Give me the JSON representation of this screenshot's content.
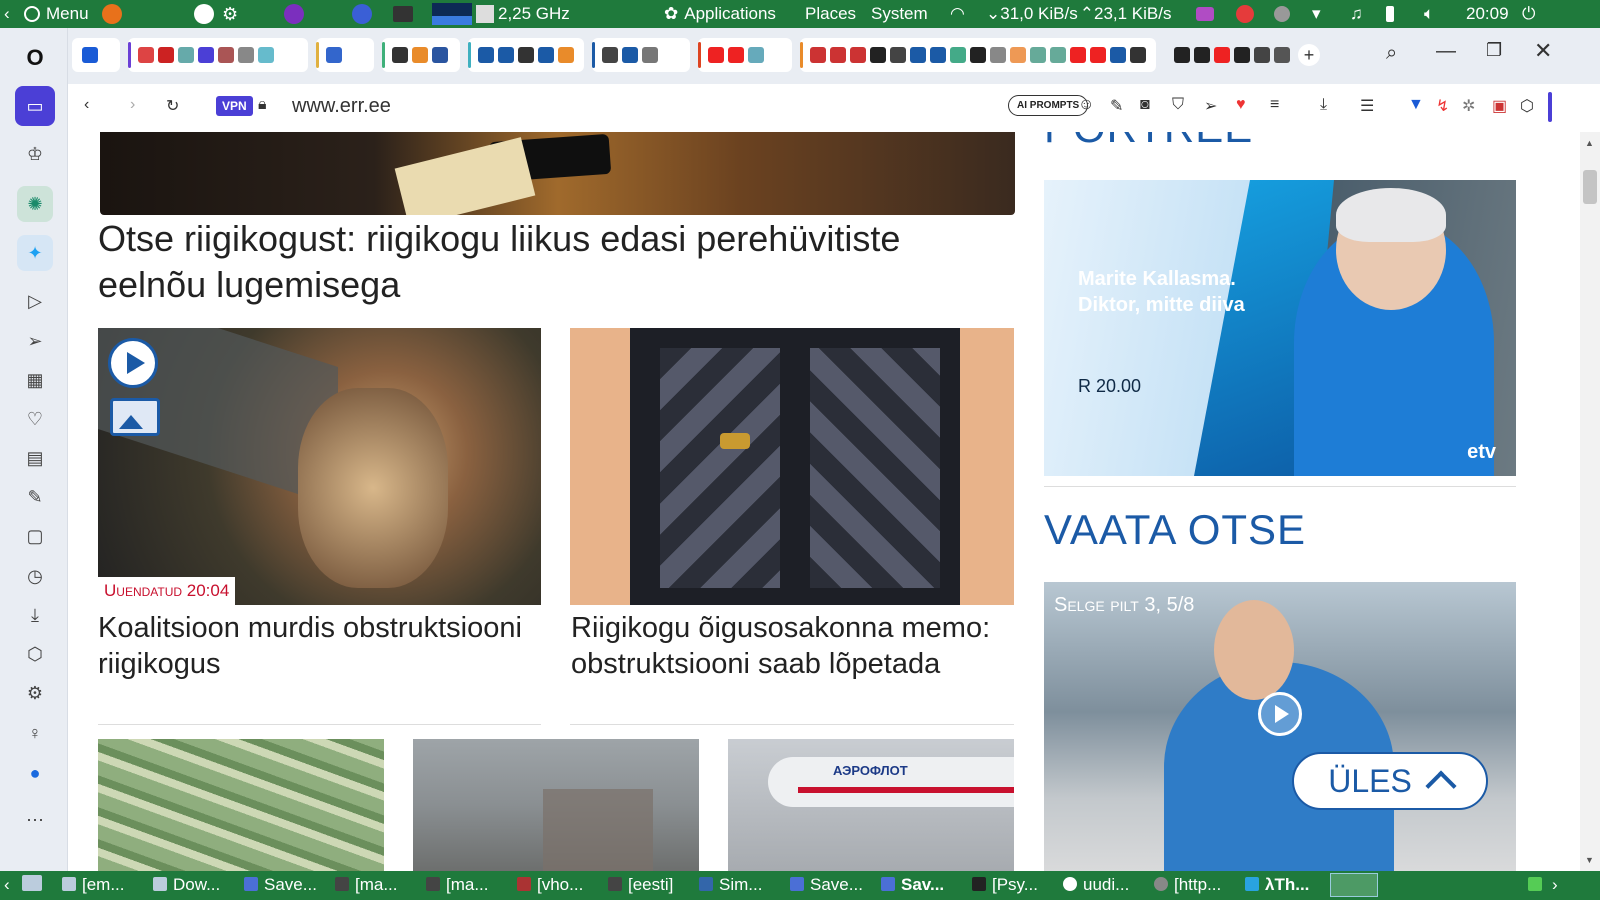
{
  "panel": {
    "menu": "Menu",
    "cpu": "2,25 GHz",
    "applications": "Applications",
    "places": "Places",
    "system": "System",
    "net_down": "31,0 KiB/s",
    "net_up": "23,1 KiB/s",
    "time": "20:09"
  },
  "browser": {
    "vpn": "VPN",
    "url": "www.err.ee",
    "ai_prompts": "AI PROMPTS"
  },
  "page": {
    "top_headline": "Otse riigikogust: riigikogu liikus edasi perehüvitiste eelnõu lugemisega",
    "article1": {
      "tag": "Uuendatud 20:04",
      "title": "Koalitsioon murdis obstruktsiooni riigikogus"
    },
    "article2": {
      "title": "Riigikogu õigusosakonna memo: obstruktsiooni saab lõpetada"
    },
    "sidebar_heading_partial": "PORTREE",
    "promo": {
      "line1": "Marite Kallasma.",
      "line2": "Diktor, mitte diiva",
      "time": "R 20.00",
      "brand": "etv"
    },
    "live_heading": "VAATA OTSE",
    "live_video": {
      "title": "Selge pilt 3, 5/8"
    },
    "up_button": "ÜLES",
    "plane_text": "АЭРОФЛОТ"
  },
  "taskbar": [
    "[em...",
    "Dow...",
    "Save...",
    "[ma...",
    "[ma...",
    "[vho...",
    "[eesti]",
    "Sim...",
    "Save...",
    "Sav...",
    "[Psy...",
    "uudi...",
    "[http...",
    "λTh..."
  ],
  "colors": {
    "panel": "#1f7a3c",
    "accent": "#1b5aa6",
    "vpn": "#4b3fd6"
  }
}
